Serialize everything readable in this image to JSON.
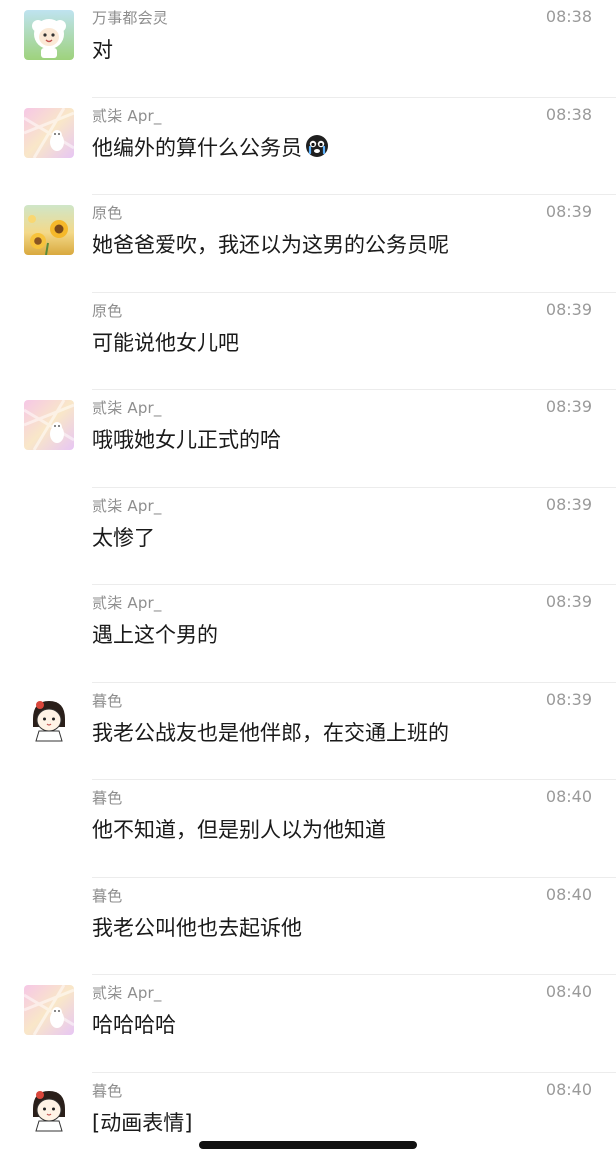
{
  "messages": [
    {
      "sender": "万事都会灵",
      "time": "08:38",
      "text": "对",
      "avatar": "sheep-avatar"
    },
    {
      "sender": "贰柒 Apr_",
      "time": "08:38",
      "text": "他编外的算什么公务员",
      "avatar": "pink-cartoon-avatar",
      "emoji": "crying-face-icon"
    },
    {
      "sender": "原色",
      "time": "08:39",
      "text": "她爸爸爱吹，我还以为这男的公务员呢",
      "avatar": "sunflower-avatar"
    },
    {
      "sender": "原色",
      "time": "08:39",
      "text": "可能说他女儿吧",
      "avatar": ""
    },
    {
      "sender": "贰柒 Apr_",
      "time": "08:39",
      "text": "哦哦她女儿正式的哈",
      "avatar": "pink-cartoon-avatar"
    },
    {
      "sender": "贰柒 Apr_",
      "time": "08:39",
      "text": "太惨了",
      "avatar": ""
    },
    {
      "sender": "贰柒 Apr_",
      "time": "08:39",
      "text": "遇上这个男的",
      "avatar": ""
    },
    {
      "sender": "暮色",
      "time": "08:39",
      "text": "我老公战友也是他伴郎，在交通上班的",
      "avatar": "doodle-girl-avatar"
    },
    {
      "sender": "暮色",
      "time": "08:40",
      "text": "他不知道，但是别人以为他知道",
      "avatar": ""
    },
    {
      "sender": "暮色",
      "time": "08:40",
      "text": "我老公叫他也去起诉他",
      "avatar": ""
    },
    {
      "sender": "贰柒 Apr_",
      "time": "08:40",
      "text": "哈哈哈哈",
      "avatar": "pink-cartoon-avatar"
    },
    {
      "sender": "暮色",
      "time": "08:40",
      "text": "[动画表情]",
      "avatar": "doodle-girl-avatar"
    }
  ],
  "colors": {
    "sender": "#8e8e8e",
    "time": "#9a9a9a",
    "text": "#1a1a1a",
    "divider": "#ececec",
    "home_indicator": "#111111"
  }
}
